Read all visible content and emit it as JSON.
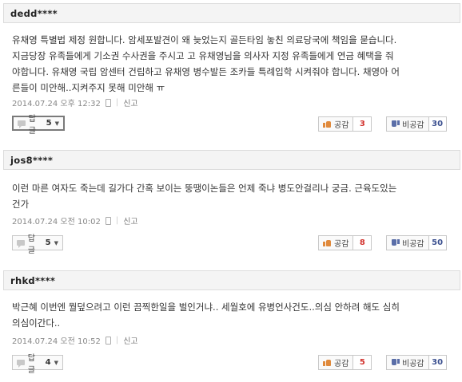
{
  "comments": [
    {
      "user": "dedd****",
      "lines": [
        "유채영 특별법 제정 원합니다. 암세포발견이 왜 늦었는지 골든타임 놓친 의료당국에 책임을 묻습니다.",
        "지금당장 유족들에게 기소권 수사권을 주시고 고 유채영님을 의사자 지정 유족들에게 연금 혜택을 줘",
        "야합니다. 유채영 국립 암센터 건립하고 유채영 병수발든 조카들 특례입학 시켜줘야 합니다. 채영아 어",
        "른들이 미안해..지켜주지 못해 미안해 ㅠ"
      ],
      "date": "2014.07.24 오후 12:32",
      "report": "신고",
      "reply_label": "답글",
      "reply_count": "5",
      "like_label": "공감",
      "like_count": "3",
      "dislike_label": "비공감",
      "dislike_count": "30"
    },
    {
      "user": "jos8****",
      "lines": [
        "이런 마른 여자도 죽는데 길가다 간혹 보이는 뚱땡이논들은 언제 죽냐 병도안걸리나 궁금. 근육도있는",
        "건가"
      ],
      "date": "2014.07.24 오전 10:02",
      "report": "신고",
      "reply_label": "답글",
      "reply_count": "5",
      "like_label": "공감",
      "like_count": "8",
      "dislike_label": "비공감",
      "dislike_count": "50"
    },
    {
      "user": "rhkd****",
      "lines": [
        "박근혜 이번엔 뭘덮으려고 이런 끔찍한일을 벌인거냐.. 세월호에 유병언사건도..의심 안하려 해도 심히",
        "의심이간다.."
      ],
      "date": "2014.07.24 오전 10:52",
      "report": "신고",
      "reply_label": "답글",
      "reply_count": "4",
      "like_label": "공감",
      "like_count": "5",
      "dislike_label": "비공감",
      "dislike_count": "30"
    }
  ]
}
